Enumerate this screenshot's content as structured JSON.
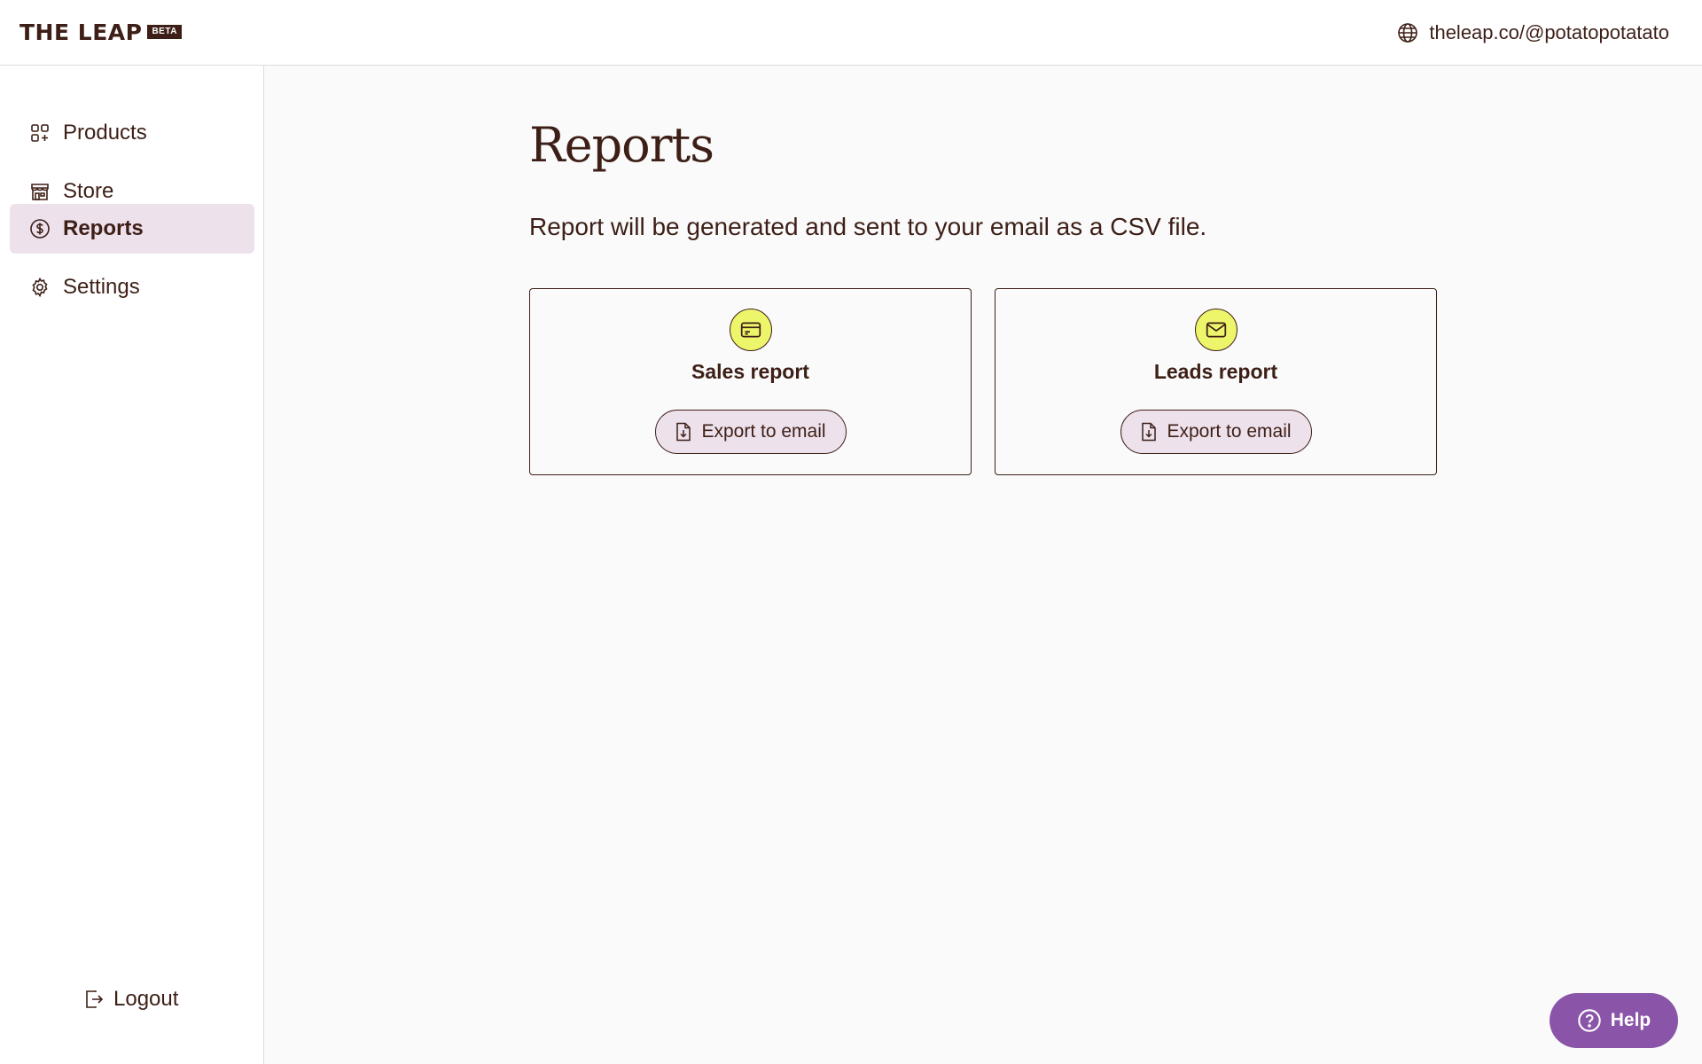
{
  "header": {
    "logo_text": "THE LEAP",
    "logo_badge": "BETA",
    "store_url": "theleap.co/@potatopotatato"
  },
  "sidebar": {
    "items": [
      {
        "label": "Products",
        "icon": "products-grid-icon",
        "active": false
      },
      {
        "label": "Store",
        "icon": "storefront-icon",
        "active": false
      },
      {
        "label": "Reports",
        "icon": "dollar-circle-icon",
        "active": true
      },
      {
        "label": "Settings",
        "icon": "gear-icon",
        "active": false
      }
    ],
    "logout_label": "Logout"
  },
  "main": {
    "title": "Reports",
    "subtitle": "Report will be generated and sent to your email as a CSV file.",
    "cards": [
      {
        "title": "Sales report",
        "icon": "credit-card-icon",
        "button_label": "Export to email"
      },
      {
        "title": "Leads report",
        "icon": "envelope-icon",
        "button_label": "Export to email"
      }
    ]
  },
  "help": {
    "label": "Help"
  },
  "colors": {
    "text": "#3d1f17",
    "active_bg": "#ede1ec",
    "icon_bg": "#edf56b",
    "help_bg": "#8a55a8"
  }
}
